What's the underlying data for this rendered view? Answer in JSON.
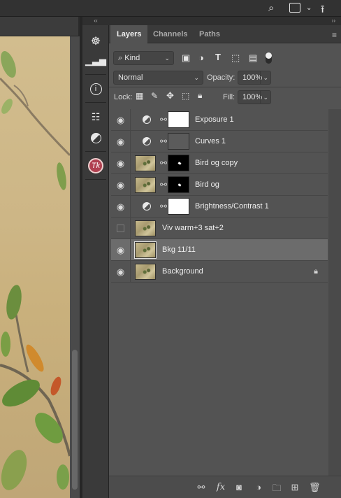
{
  "toolbar": {
    "icons": [
      "search-icon",
      "workspace-icon",
      "chevron-down-icon",
      "share-icon"
    ]
  },
  "icon_strip": {
    "collapse": "‹‹",
    "icons": [
      "navigator-icon",
      "histogram-icon",
      "info-icon",
      "properties-icon",
      "adjustments-icon",
      "tk-icon"
    ],
    "tk_label": "Tk"
  },
  "panel": {
    "collapse": "››",
    "tabs": [
      {
        "label": "Layers",
        "active": true
      },
      {
        "label": "Channels",
        "active": false
      },
      {
        "label": "Paths",
        "active": false
      }
    ],
    "filter": {
      "label": "Kind"
    },
    "blend": {
      "mode": "Normal",
      "opacity_label": "Opacity:",
      "opacity": "100%"
    },
    "lock": {
      "label": "Lock:",
      "fill_label": "Fill:",
      "fill": "100%"
    },
    "layers": [
      {
        "name": "Exposure 1",
        "visible": true,
        "kind": "adjustment",
        "mask": "white",
        "selected": false
      },
      {
        "name": "Curves 1",
        "visible": true,
        "kind": "adjustment",
        "mask": "curves",
        "selected": false
      },
      {
        "name": "Bird og copy",
        "visible": true,
        "kind": "image",
        "mask": "black",
        "selected": false
      },
      {
        "name": "Bird og",
        "visible": true,
        "kind": "image",
        "mask": "black",
        "selected": false
      },
      {
        "name": "Brightness/Contrast 1",
        "visible": true,
        "kind": "adjustment",
        "mask": "white",
        "selected": false
      },
      {
        "name": "Viv warm+3 sat+2",
        "visible": false,
        "kind": "image-only",
        "selected": false
      },
      {
        "name": "Bkg 11/11",
        "visible": true,
        "kind": "image-only",
        "selected": true
      },
      {
        "name": "Background",
        "visible": true,
        "kind": "image-only",
        "locked": true,
        "selected": false
      }
    ],
    "bottom_icons": [
      "link-icon",
      "fx-icon",
      "mask-icon",
      "adjustment-icon",
      "folder-icon",
      "new-layer-icon",
      "trash-icon"
    ],
    "fx_label": "fx"
  },
  "colors": {
    "panel_bg": "#535353",
    "selected_row": "#6c6c6c",
    "canvas_tan": "#cdb686"
  }
}
